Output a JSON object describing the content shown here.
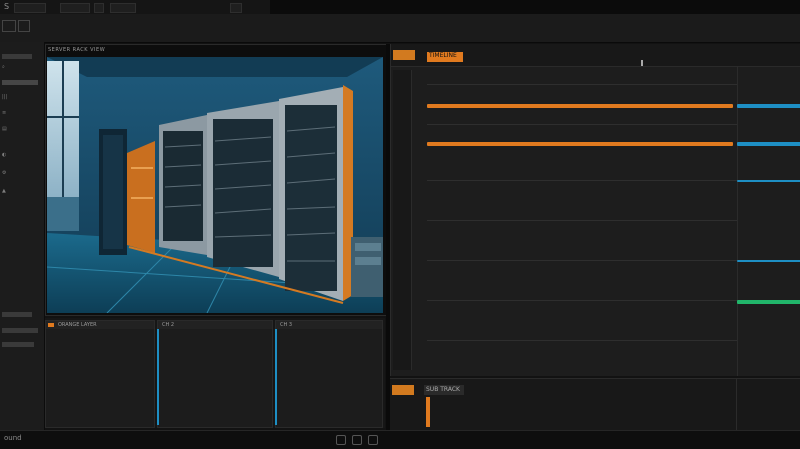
{
  "viewer": {
    "title": "SERVER RACK VIEW"
  },
  "thumbs": {
    "labels": [
      "ORANGE LAYER",
      "CH 2",
      "CH 3"
    ]
  },
  "left_panel": {
    "items": [
      "⌕",
      "|||",
      "≡",
      "▤",
      "◐",
      "⚙",
      "▲"
    ]
  },
  "timeline": {
    "title": "TIMELINE",
    "lower_title": "SUB TRACK"
  },
  "status": {
    "text": "ound"
  },
  "colors": {
    "accent_orange": "#e07a1f",
    "accent_blue": "#1e8fc4",
    "accent_green": "#21b56a"
  },
  "icons": [
    "gear-icon",
    "folder-icon",
    "play-icon",
    "window-controls-icon"
  ]
}
